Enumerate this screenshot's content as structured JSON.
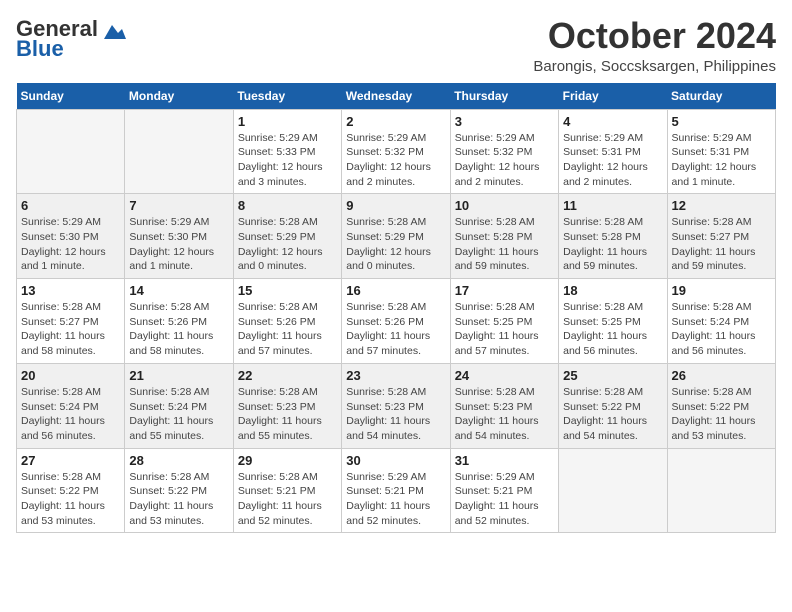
{
  "logo": {
    "line1": "General",
    "line2": "Blue",
    "tagline": ""
  },
  "title": "October 2024",
  "location": "Barongis, Soccsksargen, Philippines",
  "days_of_week": [
    "Sunday",
    "Monday",
    "Tuesday",
    "Wednesday",
    "Thursday",
    "Friday",
    "Saturday"
  ],
  "weeks": [
    [
      {
        "day": "",
        "info": ""
      },
      {
        "day": "",
        "info": ""
      },
      {
        "day": "1",
        "info": "Sunrise: 5:29 AM\nSunset: 5:33 PM\nDaylight: 12 hours\nand 3 minutes."
      },
      {
        "day": "2",
        "info": "Sunrise: 5:29 AM\nSunset: 5:32 PM\nDaylight: 12 hours\nand 2 minutes."
      },
      {
        "day": "3",
        "info": "Sunrise: 5:29 AM\nSunset: 5:32 PM\nDaylight: 12 hours\nand 2 minutes."
      },
      {
        "day": "4",
        "info": "Sunrise: 5:29 AM\nSunset: 5:31 PM\nDaylight: 12 hours\nand 2 minutes."
      },
      {
        "day": "5",
        "info": "Sunrise: 5:29 AM\nSunset: 5:31 PM\nDaylight: 12 hours\nand 1 minute."
      }
    ],
    [
      {
        "day": "6",
        "info": "Sunrise: 5:29 AM\nSunset: 5:30 PM\nDaylight: 12 hours\nand 1 minute."
      },
      {
        "day": "7",
        "info": "Sunrise: 5:29 AM\nSunset: 5:30 PM\nDaylight: 12 hours\nand 1 minute."
      },
      {
        "day": "8",
        "info": "Sunrise: 5:28 AM\nSunset: 5:29 PM\nDaylight: 12 hours\nand 0 minutes."
      },
      {
        "day": "9",
        "info": "Sunrise: 5:28 AM\nSunset: 5:29 PM\nDaylight: 12 hours\nand 0 minutes."
      },
      {
        "day": "10",
        "info": "Sunrise: 5:28 AM\nSunset: 5:28 PM\nDaylight: 11 hours\nand 59 minutes."
      },
      {
        "day": "11",
        "info": "Sunrise: 5:28 AM\nSunset: 5:28 PM\nDaylight: 11 hours\nand 59 minutes."
      },
      {
        "day": "12",
        "info": "Sunrise: 5:28 AM\nSunset: 5:27 PM\nDaylight: 11 hours\nand 59 minutes."
      }
    ],
    [
      {
        "day": "13",
        "info": "Sunrise: 5:28 AM\nSunset: 5:27 PM\nDaylight: 11 hours\nand 58 minutes."
      },
      {
        "day": "14",
        "info": "Sunrise: 5:28 AM\nSunset: 5:26 PM\nDaylight: 11 hours\nand 58 minutes."
      },
      {
        "day": "15",
        "info": "Sunrise: 5:28 AM\nSunset: 5:26 PM\nDaylight: 11 hours\nand 57 minutes."
      },
      {
        "day": "16",
        "info": "Sunrise: 5:28 AM\nSunset: 5:26 PM\nDaylight: 11 hours\nand 57 minutes."
      },
      {
        "day": "17",
        "info": "Sunrise: 5:28 AM\nSunset: 5:25 PM\nDaylight: 11 hours\nand 57 minutes."
      },
      {
        "day": "18",
        "info": "Sunrise: 5:28 AM\nSunset: 5:25 PM\nDaylight: 11 hours\nand 56 minutes."
      },
      {
        "day": "19",
        "info": "Sunrise: 5:28 AM\nSunset: 5:24 PM\nDaylight: 11 hours\nand 56 minutes."
      }
    ],
    [
      {
        "day": "20",
        "info": "Sunrise: 5:28 AM\nSunset: 5:24 PM\nDaylight: 11 hours\nand 56 minutes."
      },
      {
        "day": "21",
        "info": "Sunrise: 5:28 AM\nSunset: 5:24 PM\nDaylight: 11 hours\nand 55 minutes."
      },
      {
        "day": "22",
        "info": "Sunrise: 5:28 AM\nSunset: 5:23 PM\nDaylight: 11 hours\nand 55 minutes."
      },
      {
        "day": "23",
        "info": "Sunrise: 5:28 AM\nSunset: 5:23 PM\nDaylight: 11 hours\nand 54 minutes."
      },
      {
        "day": "24",
        "info": "Sunrise: 5:28 AM\nSunset: 5:23 PM\nDaylight: 11 hours\nand 54 minutes."
      },
      {
        "day": "25",
        "info": "Sunrise: 5:28 AM\nSunset: 5:22 PM\nDaylight: 11 hours\nand 54 minutes."
      },
      {
        "day": "26",
        "info": "Sunrise: 5:28 AM\nSunset: 5:22 PM\nDaylight: 11 hours\nand 53 minutes."
      }
    ],
    [
      {
        "day": "27",
        "info": "Sunrise: 5:28 AM\nSunset: 5:22 PM\nDaylight: 11 hours\nand 53 minutes."
      },
      {
        "day": "28",
        "info": "Sunrise: 5:28 AM\nSunset: 5:22 PM\nDaylight: 11 hours\nand 53 minutes."
      },
      {
        "day": "29",
        "info": "Sunrise: 5:28 AM\nSunset: 5:21 PM\nDaylight: 11 hours\nand 52 minutes."
      },
      {
        "day": "30",
        "info": "Sunrise: 5:29 AM\nSunset: 5:21 PM\nDaylight: 11 hours\nand 52 minutes."
      },
      {
        "day": "31",
        "info": "Sunrise: 5:29 AM\nSunset: 5:21 PM\nDaylight: 11 hours\nand 52 minutes."
      },
      {
        "day": "",
        "info": ""
      },
      {
        "day": "",
        "info": ""
      }
    ]
  ]
}
